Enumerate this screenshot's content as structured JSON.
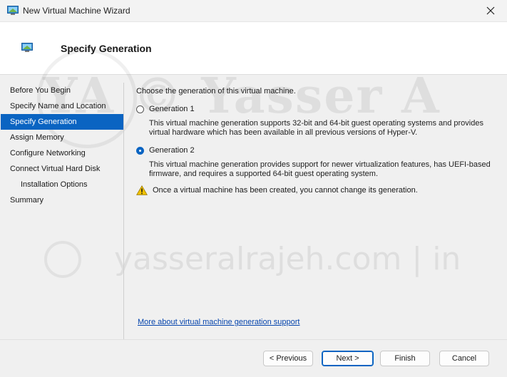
{
  "window": {
    "title": "New Virtual Machine Wizard"
  },
  "header": {
    "title": "Specify Generation"
  },
  "watermark": {
    "text_large": "YA © Yasser A",
    "text_small": "yasseralrajeh.com  |  in"
  },
  "nav": {
    "items": [
      {
        "label": "Before You Begin",
        "active": false,
        "sub": false
      },
      {
        "label": "Specify Name and Location",
        "active": false,
        "sub": false
      },
      {
        "label": "Specify Generation",
        "active": true,
        "sub": false
      },
      {
        "label": "Assign Memory",
        "active": false,
        "sub": false
      },
      {
        "label": "Configure Networking",
        "active": false,
        "sub": false
      },
      {
        "label": "Connect Virtual Hard Disk",
        "active": false,
        "sub": false
      },
      {
        "label": "Installation Options",
        "active": false,
        "sub": true
      },
      {
        "label": "Summary",
        "active": false,
        "sub": false
      }
    ]
  },
  "content": {
    "prompt": "Choose the generation of this virtual machine.",
    "gen1": {
      "label": "Generation 1",
      "selected": false,
      "line1": "This virtual machine generation supports 32-bit and 64-bit guest operating systems and provides",
      "line2": "virtual hardware which has been available in all previous versions of Hyper-V."
    },
    "gen2": {
      "label": "Generation 2",
      "selected": true,
      "line1": "This virtual machine generation provides support for newer virtualization features, has UEFI-based",
      "line2": "firmware, and requires a supported 64-bit guest operating system."
    },
    "warning": "Once a virtual machine has been created, you cannot change its generation.",
    "more_link": "More about virtual machine generation support"
  },
  "buttons": {
    "previous": "< Previous",
    "next": "Next >",
    "finish": "Finish",
    "cancel": "Cancel"
  },
  "colors": {
    "accent": "#0a64c2",
    "link": "#0645ad",
    "warning": "#f2c200"
  }
}
